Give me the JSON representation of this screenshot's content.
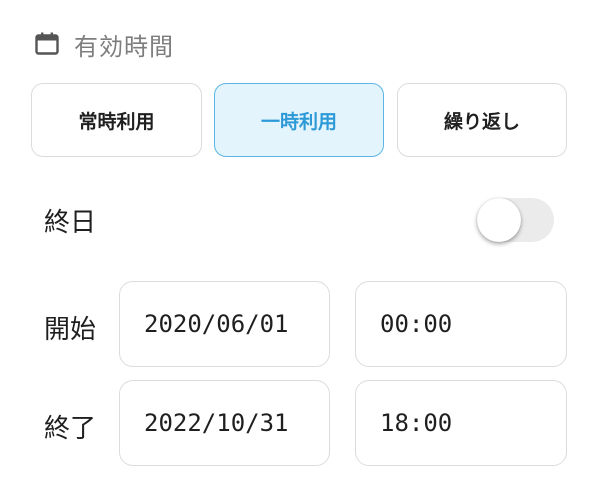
{
  "section": {
    "icon": "calendar-icon",
    "title": "有効時間"
  },
  "usage_type": {
    "options": [
      "常時利用",
      "一時利用",
      "繰り返し"
    ],
    "selected": "一時利用"
  },
  "all_day": {
    "label": "終日",
    "enabled": false
  },
  "start": {
    "label": "開始",
    "date": "2020/06/01",
    "time": "00:00"
  },
  "end": {
    "label": "終了",
    "date": "2022/10/31",
    "time": "18:00"
  },
  "colors": {
    "accent": "#2d9ad7",
    "accent_background": "#e3f4fd",
    "border": "#dcdcdc",
    "toggle_off": "#ebebeb"
  }
}
